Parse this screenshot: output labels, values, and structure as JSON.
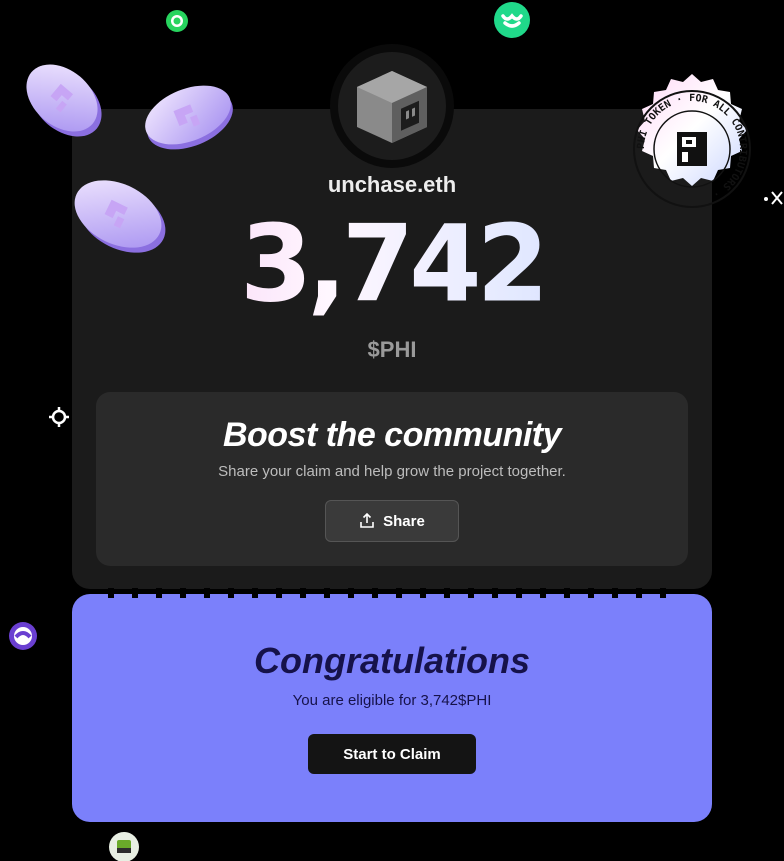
{
  "profile": {
    "username": "unchase.eth"
  },
  "reward": {
    "amount": "3,742",
    "token": "$PHI"
  },
  "boost": {
    "title": "Boost the community",
    "subtitle": "Share your claim and help grow the project together.",
    "share_label": "Share"
  },
  "congrats": {
    "title": "Congratulations",
    "subtitle": "You are eligible for 3,742$PHI",
    "claim_label": "Start to Claim"
  },
  "badge": {
    "text": "PHI TOKEN · FOR ALL CONTRIBUTORS ·"
  },
  "colors": {
    "background": "#000000",
    "card": "#1b1b1b",
    "congrats_card": "#7b80fb",
    "congrats_text": "#16124a",
    "button_dark": "#141414"
  },
  "icons": [
    "share-icon",
    "cube-avatar-icon",
    "coin-icon",
    "badge-seal-icon",
    "crosshair-icon",
    "close-icon"
  ]
}
